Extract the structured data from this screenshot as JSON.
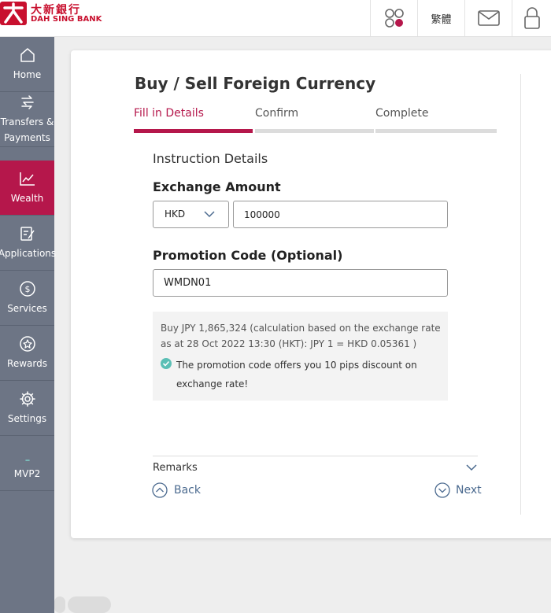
{
  "brand": {
    "name_zh": "大新銀行",
    "name_en": "DAH SING BANK",
    "color": "#c8102e"
  },
  "topbar": {
    "apps_icon": "apps-icon",
    "language_label": "繁體",
    "mail_icon": "mail-icon",
    "lock_icon": "lock-icon"
  },
  "sidebar": {
    "items": [
      {
        "label": "Home",
        "icon": "home-icon"
      },
      {
        "label_line1": "Transfers &",
        "label_line2": "Payments",
        "icon": "transfer-icon"
      },
      {
        "label": "Wealth",
        "icon": "chart-icon",
        "active": true
      },
      {
        "label": "Applications",
        "icon": "edit-icon"
      },
      {
        "label": "Services",
        "icon": "dollar-icon"
      },
      {
        "label": "Rewards",
        "icon": "star-icon"
      },
      {
        "label": "Settings",
        "icon": "gear-icon"
      },
      {
        "label": "MVP2",
        "icon": "dash-icon"
      }
    ],
    "active_color": "#b5174b"
  },
  "main": {
    "title": "Buy / Sell Foreign Currency",
    "steps": [
      {
        "label": "Fill in Details",
        "active": true
      },
      {
        "label": "Confirm",
        "active": false
      },
      {
        "label": "Complete",
        "active": false
      }
    ],
    "section_title": "Instruction Details",
    "exchange_amount": {
      "label": "Exchange Amount",
      "currency": "HKD",
      "amount": "100000"
    },
    "promotion": {
      "label": "Promotion Code (Optional)",
      "code": "WMDN01"
    },
    "info": {
      "calculation": "Buy JPY 1,865,324 (calculation based on the exchange rate as at 28 Oct 2022 13:30 (HKT): JPY 1 = HKD 0.05361 )",
      "promo_message": "The promotion code offers you 10 pips discount on exchange rate!"
    },
    "remarks_label": "Remarks",
    "back_label": "Back",
    "next_label": "Next"
  }
}
